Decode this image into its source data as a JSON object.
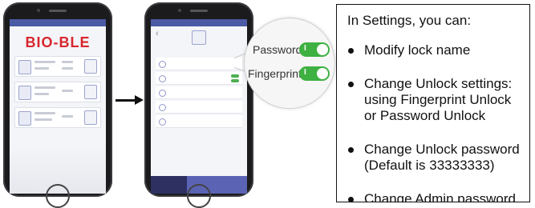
{
  "phone_home": {
    "brand": "BIO-BLE"
  },
  "zoom": {
    "rows": [
      {
        "label": "Password",
        "toggle": "I"
      },
      {
        "label": "Fingerprint",
        "toggle": "I"
      }
    ],
    "toggle_color": "#3fb042"
  },
  "info": {
    "heading": "In Settings, you can:",
    "items": [
      "Modify lock name",
      "Change Unlock settings: using Fingerprint Unlock or Password Unlock",
      "Change Unlock password (Default is 33333333)",
      "Change Admin password"
    ]
  },
  "colors": {
    "brand_red": "#d8262e",
    "app_blue": "#5b63b5"
  }
}
